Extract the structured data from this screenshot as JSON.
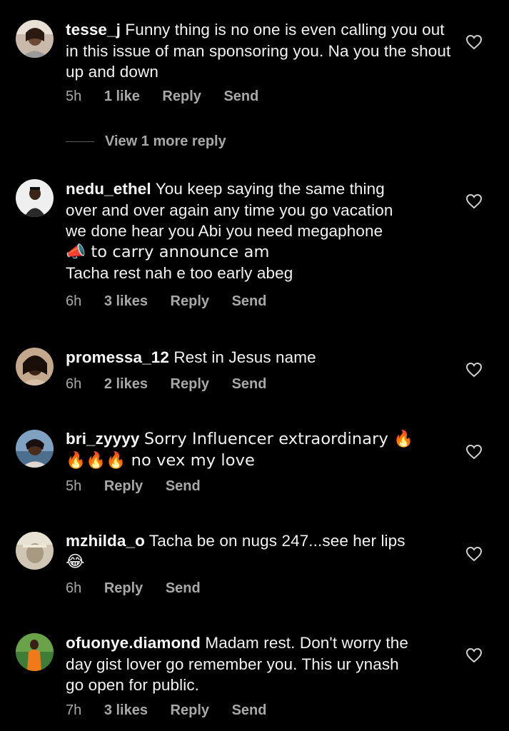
{
  "comments": [
    {
      "username": "tesse_j",
      "text": "Funny thing is no one is even calling you out in this issue of man sponsoring you. Na you the shout up and down",
      "time": "5h",
      "likes": "1 like",
      "reply": "Reply",
      "send": "Send",
      "avatar_color": "#8a6a55"
    },
    {
      "username": "nedu_ethel",
      "text_lines": [
        "You keep saying the same thing",
        "over and over again any time you go vacation",
        "we done hear you Abi you need megaphone",
        "📣 to carry announce am",
        "Tacha rest nah e too early abeg"
      ],
      "time": "6h",
      "likes": "3 likes",
      "reply": "Reply",
      "send": "Send",
      "avatar_color": "#d9d9d9"
    },
    {
      "username": "promessa_12",
      "text": "Rest in Jesus name",
      "time": "6h",
      "likes": "2 likes",
      "reply": "Reply",
      "send": "Send",
      "avatar_color": "#5a3a2a"
    },
    {
      "username": "bri_zyyyy",
      "text_lines": [
        "Sorry Influencer extraordinary 🔥",
        "🔥🔥🔥 no vex my love"
      ],
      "time": "5h",
      "reply": "Reply",
      "send": "Send",
      "avatar_color": "#6c8ba8"
    },
    {
      "username": "mzhilda_o",
      "text_lines": [
        "Tacha be on nugs 247...see her lips",
        "😂"
      ],
      "time": "6h",
      "reply": "Reply",
      "send": "Send",
      "avatar_color": "#b9b3a6"
    },
    {
      "username": "ofuonye.diamond",
      "text_lines": [
        "Madam rest. Don't worry the",
        "day gist lover go remember you. This ur ynash",
        "go open for public."
      ],
      "time": "7h",
      "likes": "3 likes",
      "reply": "Reply",
      "send": "Send",
      "avatar_color": "#4a8a3a"
    }
  ],
  "view_more": "View 1 more reply",
  "colors": {
    "background": "#000000",
    "text": "#f2f2f2",
    "meta": "#a8a8a8"
  }
}
